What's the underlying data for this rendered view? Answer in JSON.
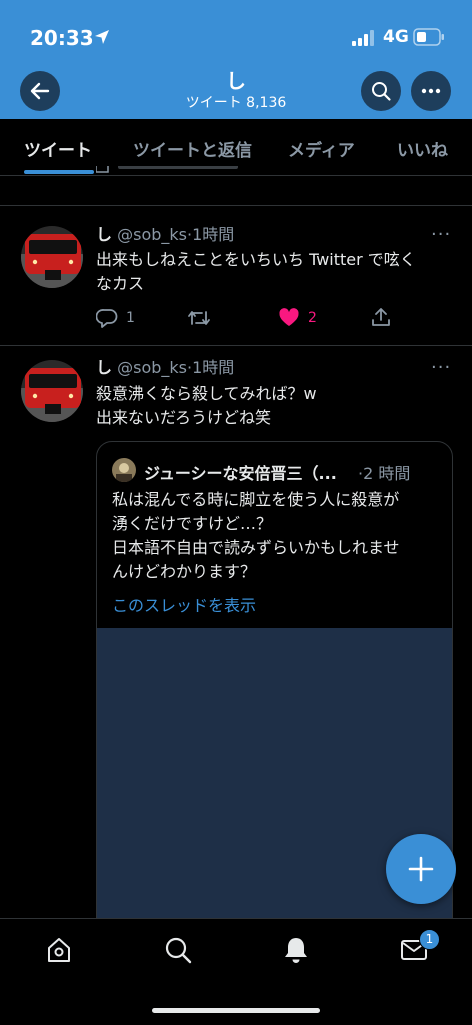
{
  "status_bar": {
    "time": "20:33",
    "network": "4G"
  },
  "header": {
    "title": "し",
    "subtitle": "ツイート 8,136"
  },
  "tabs": [
    "ツイート",
    "ツイートと返信",
    "メディア",
    "いいね"
  ],
  "tweets": [
    {
      "name": "し",
      "handle": "@sob_ks",
      "time": "·1時間",
      "text_lines": [
        "出来もしねえことをいちいち Twitter で呟く",
        "なカス"
      ],
      "reply_count": "1",
      "like_count": "2",
      "liked": true
    },
    {
      "name": "し",
      "handle": "@sob_ks",
      "time": "·1時間",
      "text_lines": [
        "殺意沸くなら殺してみれば？w",
        "出来ないだろうけどね笑"
      ],
      "quote": {
        "name": "ジューシーな安倍晋三（...",
        "time": "·2 時間",
        "text_lines": [
          "私は混んでる時に脚立を使う人に殺意が",
          "湧くだけですけど…？",
          "日本語不自由で読みずらいかもしれませ",
          "んけどわかります？"
        ],
        "link": "このスレッドを表示"
      }
    }
  ],
  "nav": {
    "messages_badge": "1"
  },
  "colors": {
    "accent": "#3a8fd6",
    "like": "#f91880",
    "background": "#000000",
    "media": "#1e2f47"
  },
  "icons": [
    "back-arrow-icon",
    "search-icon",
    "more-icon",
    "reply-icon",
    "retweet-icon",
    "heart-icon",
    "share-icon",
    "compose-icon",
    "home-icon",
    "bell-icon",
    "mail-icon"
  ]
}
